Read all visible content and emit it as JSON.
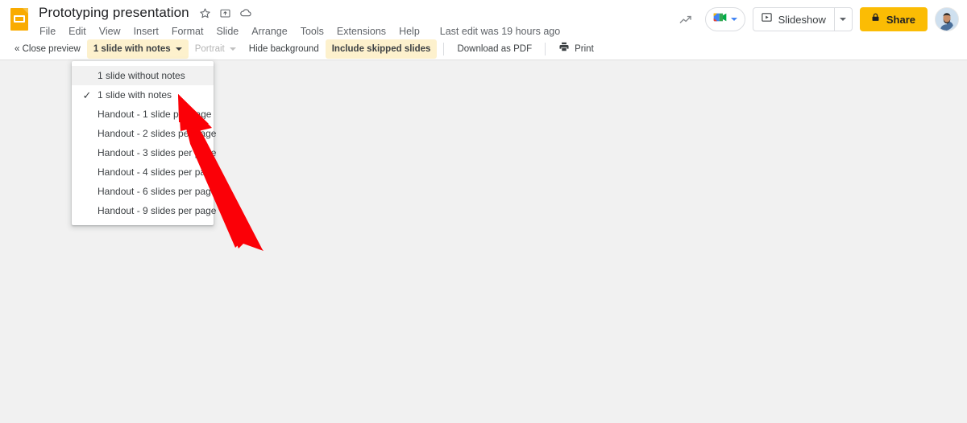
{
  "header": {
    "logo_icon": "google-slides-icon",
    "doc_title": "Prototyping presentation",
    "title_icons": [
      {
        "name": "star-icon",
        "glyph": "☆"
      },
      {
        "name": "move-to-folder-icon",
        "glyph": "⧉"
      },
      {
        "name": "cloud-saved-icon",
        "glyph": "☁"
      }
    ],
    "menu_items": [
      "File",
      "Edit",
      "View",
      "Insert",
      "Format",
      "Slide",
      "Arrange",
      "Tools",
      "Extensions",
      "Help"
    ],
    "last_edit": "Last edit was 19 hours ago",
    "right": {
      "activity_icon": "trending-chart-icon",
      "meet_icon": "google-meet-icon",
      "slideshow_icon": "present-play-icon",
      "slideshow_label": "Slideshow",
      "slideshow_arrow_icon": "chevron-down-icon",
      "share_lock_icon": "lock-icon",
      "share_label": "Share",
      "avatar_name": "user-avatar"
    }
  },
  "toolbar": {
    "close_preview": "« Close preview",
    "layout_select": "1 slide with notes",
    "layout_caret_icon": "chevron-down-icon",
    "orientation_select": "Portrait",
    "orientation_caret_icon": "chevron-down-icon",
    "hide_background": "Hide background",
    "include_skipped": "Include skipped slides",
    "download_pdf": "Download as PDF",
    "print_icon": "printer-icon",
    "print_label": "Print"
  },
  "dropdown": {
    "items": [
      {
        "label": "1 slide without notes",
        "checked": false,
        "hover": true
      },
      {
        "label": "1 slide with notes",
        "checked": true,
        "hover": false
      },
      {
        "label": "Handout - 1 slide per page",
        "checked": false,
        "hover": false
      },
      {
        "label": "Handout - 2 slides per page",
        "checked": false,
        "hover": false
      },
      {
        "label": "Handout - 3 slides per page",
        "checked": false,
        "hover": false
      },
      {
        "label": "Handout - 4 slides per page",
        "checked": false,
        "hover": false
      },
      {
        "label": "Handout - 6 slides per page",
        "checked": false,
        "hover": false
      },
      {
        "label": "Handout - 9 slides per page",
        "checked": false,
        "hover": false
      }
    ],
    "check_glyph": "✓"
  },
  "annotation": {
    "arrow_name": "red-pointer-arrow",
    "color": "#fb0007"
  },
  "colors": {
    "brand_yellow": "#fbbc04",
    "logo_amber": "#f9ab00",
    "highlight": "#fdf1cd",
    "canvas_bg": "#f1f1f1",
    "text_primary": "#202124",
    "text_secondary": "#5f6368"
  }
}
